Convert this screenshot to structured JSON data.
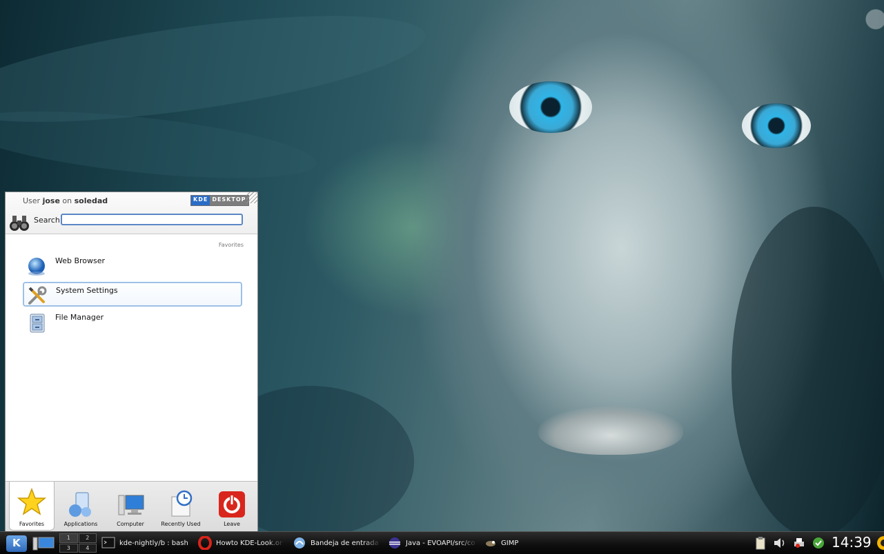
{
  "menu": {
    "user_prefix": "User",
    "username": "jose",
    "host_prefix": "on",
    "hostname": "soledad",
    "badge_left": "KDE",
    "badge_right": "DESKTOP",
    "search_label": "Search:",
    "search_value": "",
    "section_label": "Favorites",
    "favorites": [
      {
        "label": "Web Browser",
        "icon": "globe-icon"
      },
      {
        "label": "System Settings",
        "icon": "wrench-screwdriver-icon"
      },
      {
        "label": "File Manager",
        "icon": "file-cabinet-icon"
      }
    ],
    "tabs": [
      {
        "label": "Favorites",
        "icon": "star-icon"
      },
      {
        "label": "Applications",
        "icon": "applications-icon"
      },
      {
        "label": "Computer",
        "icon": "computer-icon"
      },
      {
        "label": "Recently Used",
        "icon": "clock-document-icon"
      },
      {
        "label": "Leave",
        "icon": "power-icon"
      }
    ]
  },
  "taskbar": {
    "pager": [
      "1",
      "2",
      "3",
      "4"
    ],
    "tasks": [
      {
        "label": "kde-nightly/b : bash",
        "icon": "terminal-icon"
      },
      {
        "label": "Howto KDE-Look.or",
        "icon": "opera-icon"
      },
      {
        "label": "Bandeja de entrada - T",
        "icon": "mail-icon"
      },
      {
        "label": "Java - EVOAPI/src/co",
        "icon": "eclipse-icon"
      },
      {
        "label": "GIMP",
        "icon": "gimp-icon"
      }
    ],
    "tray": [
      "clipboard-icon",
      "volume-icon",
      "printer-icon",
      "update-icon"
    ],
    "clock": "14:39"
  },
  "colors": {
    "accent": "#2e68b8",
    "selection_border": "#9ec0e6"
  }
}
